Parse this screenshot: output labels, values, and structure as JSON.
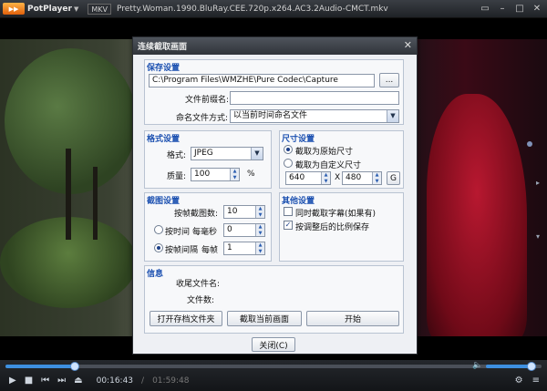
{
  "player": {
    "app_name": "PotPlayer",
    "format_badge": "MKV",
    "file_title": "Pretty.Woman.1990.BluRay.CEE.720p.x264.AC3.2Audio-CMCT.mkv",
    "time_current": "00:16:43",
    "time_separator": "/",
    "time_total": "01:59:48",
    "seek_progress": 0.13,
    "volume_level": 0.9
  },
  "dialog": {
    "title": "连续截取画面",
    "save": {
      "group_label": "保存设置",
      "path": "C:\\Program Files\\WMZHE\\Pure Codec\\Capture",
      "browse_label": "...",
      "prefix_label": "文件前缀名:",
      "prefix_value": "",
      "naming_label": "命名文件方式:",
      "naming_value": "以当前时间命名文件"
    },
    "format": {
      "group_label": "格式设置",
      "format_label": "格式:",
      "format_value": "JPEG",
      "quality_label": "质量:",
      "quality_value": "100",
      "quality_unit": "%"
    },
    "size": {
      "group_label": "尺寸设置",
      "original_label": "截取为原始尺寸",
      "custom_label": "截取为自定义尺寸",
      "width": "640",
      "x_label": "X",
      "height": "480",
      "g_label": "G"
    },
    "capture": {
      "group_label": "截图设置",
      "count_label": "按帧截图数:",
      "count_value": "10",
      "by_time_label": "按时间",
      "ms_label": "每毫秒",
      "ms_value": "0",
      "by_frame_label": "按帧间隔",
      "frame_label": "每帧",
      "frame_value": "1"
    },
    "other": {
      "group_label": "其他设置",
      "subtitle_label": "同时截取字幕(如果有)",
      "aspect_label": "按调整后的比例保存"
    },
    "info": {
      "group_label": "信息",
      "tail_label": "收尾文件名:",
      "count_label": "文件数:"
    },
    "buttons": {
      "open_folder": "打开存档文件夹",
      "capture_now": "截取当前画面",
      "start": "开始",
      "close": "关闭(C)"
    }
  },
  "colors": {
    "accent": "#3d8fe0",
    "group_title": "#1a4fb0"
  }
}
